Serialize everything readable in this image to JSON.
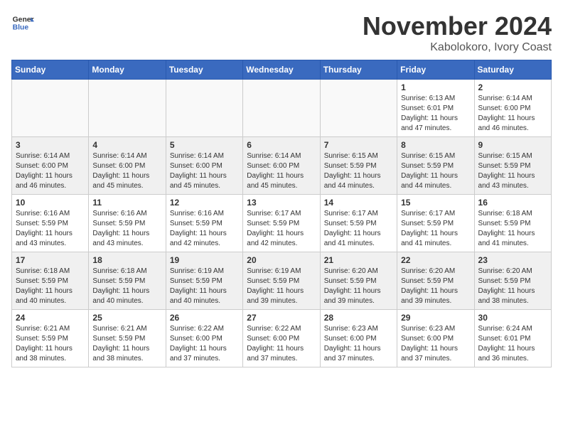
{
  "header": {
    "logo_general": "General",
    "logo_blue": "Blue",
    "month": "November 2024",
    "location": "Kabolokoro, Ivory Coast"
  },
  "days_of_week": [
    "Sunday",
    "Monday",
    "Tuesday",
    "Wednesday",
    "Thursday",
    "Friday",
    "Saturday"
  ],
  "weeks": [
    [
      {
        "day": "",
        "info": "",
        "empty": true
      },
      {
        "day": "",
        "info": "",
        "empty": true
      },
      {
        "day": "",
        "info": "",
        "empty": true
      },
      {
        "day": "",
        "info": "",
        "empty": true
      },
      {
        "day": "",
        "info": "",
        "empty": true
      },
      {
        "day": "1",
        "info": "Sunrise: 6:13 AM\nSunset: 6:01 PM\nDaylight: 11 hours\nand 47 minutes."
      },
      {
        "day": "2",
        "info": "Sunrise: 6:14 AM\nSunset: 6:00 PM\nDaylight: 11 hours\nand 46 minutes."
      }
    ],
    [
      {
        "day": "3",
        "info": "Sunrise: 6:14 AM\nSunset: 6:00 PM\nDaylight: 11 hours\nand 46 minutes."
      },
      {
        "day": "4",
        "info": "Sunrise: 6:14 AM\nSunset: 6:00 PM\nDaylight: 11 hours\nand 45 minutes."
      },
      {
        "day": "5",
        "info": "Sunrise: 6:14 AM\nSunset: 6:00 PM\nDaylight: 11 hours\nand 45 minutes."
      },
      {
        "day": "6",
        "info": "Sunrise: 6:14 AM\nSunset: 6:00 PM\nDaylight: 11 hours\nand 45 minutes."
      },
      {
        "day": "7",
        "info": "Sunrise: 6:15 AM\nSunset: 5:59 PM\nDaylight: 11 hours\nand 44 minutes."
      },
      {
        "day": "8",
        "info": "Sunrise: 6:15 AM\nSunset: 5:59 PM\nDaylight: 11 hours\nand 44 minutes."
      },
      {
        "day": "9",
        "info": "Sunrise: 6:15 AM\nSunset: 5:59 PM\nDaylight: 11 hours\nand 43 minutes."
      }
    ],
    [
      {
        "day": "10",
        "info": "Sunrise: 6:16 AM\nSunset: 5:59 PM\nDaylight: 11 hours\nand 43 minutes."
      },
      {
        "day": "11",
        "info": "Sunrise: 6:16 AM\nSunset: 5:59 PM\nDaylight: 11 hours\nand 43 minutes."
      },
      {
        "day": "12",
        "info": "Sunrise: 6:16 AM\nSunset: 5:59 PM\nDaylight: 11 hours\nand 42 minutes."
      },
      {
        "day": "13",
        "info": "Sunrise: 6:17 AM\nSunset: 5:59 PM\nDaylight: 11 hours\nand 42 minutes."
      },
      {
        "day": "14",
        "info": "Sunrise: 6:17 AM\nSunset: 5:59 PM\nDaylight: 11 hours\nand 41 minutes."
      },
      {
        "day": "15",
        "info": "Sunrise: 6:17 AM\nSunset: 5:59 PM\nDaylight: 11 hours\nand 41 minutes."
      },
      {
        "day": "16",
        "info": "Sunrise: 6:18 AM\nSunset: 5:59 PM\nDaylight: 11 hours\nand 41 minutes."
      }
    ],
    [
      {
        "day": "17",
        "info": "Sunrise: 6:18 AM\nSunset: 5:59 PM\nDaylight: 11 hours\nand 40 minutes."
      },
      {
        "day": "18",
        "info": "Sunrise: 6:18 AM\nSunset: 5:59 PM\nDaylight: 11 hours\nand 40 minutes."
      },
      {
        "day": "19",
        "info": "Sunrise: 6:19 AM\nSunset: 5:59 PM\nDaylight: 11 hours\nand 40 minutes."
      },
      {
        "day": "20",
        "info": "Sunrise: 6:19 AM\nSunset: 5:59 PM\nDaylight: 11 hours\nand 39 minutes."
      },
      {
        "day": "21",
        "info": "Sunrise: 6:20 AM\nSunset: 5:59 PM\nDaylight: 11 hours\nand 39 minutes."
      },
      {
        "day": "22",
        "info": "Sunrise: 6:20 AM\nSunset: 5:59 PM\nDaylight: 11 hours\nand 39 minutes."
      },
      {
        "day": "23",
        "info": "Sunrise: 6:20 AM\nSunset: 5:59 PM\nDaylight: 11 hours\nand 38 minutes."
      }
    ],
    [
      {
        "day": "24",
        "info": "Sunrise: 6:21 AM\nSunset: 5:59 PM\nDaylight: 11 hours\nand 38 minutes."
      },
      {
        "day": "25",
        "info": "Sunrise: 6:21 AM\nSunset: 5:59 PM\nDaylight: 11 hours\nand 38 minutes."
      },
      {
        "day": "26",
        "info": "Sunrise: 6:22 AM\nSunset: 6:00 PM\nDaylight: 11 hours\nand 37 minutes."
      },
      {
        "day": "27",
        "info": "Sunrise: 6:22 AM\nSunset: 6:00 PM\nDaylight: 11 hours\nand 37 minutes."
      },
      {
        "day": "28",
        "info": "Sunrise: 6:23 AM\nSunset: 6:00 PM\nDaylight: 11 hours\nand 37 minutes."
      },
      {
        "day": "29",
        "info": "Sunrise: 6:23 AM\nSunset: 6:00 PM\nDaylight: 11 hours\nand 37 minutes."
      },
      {
        "day": "30",
        "info": "Sunrise: 6:24 AM\nSunset: 6:01 PM\nDaylight: 11 hours\nand 36 minutes."
      }
    ]
  ]
}
